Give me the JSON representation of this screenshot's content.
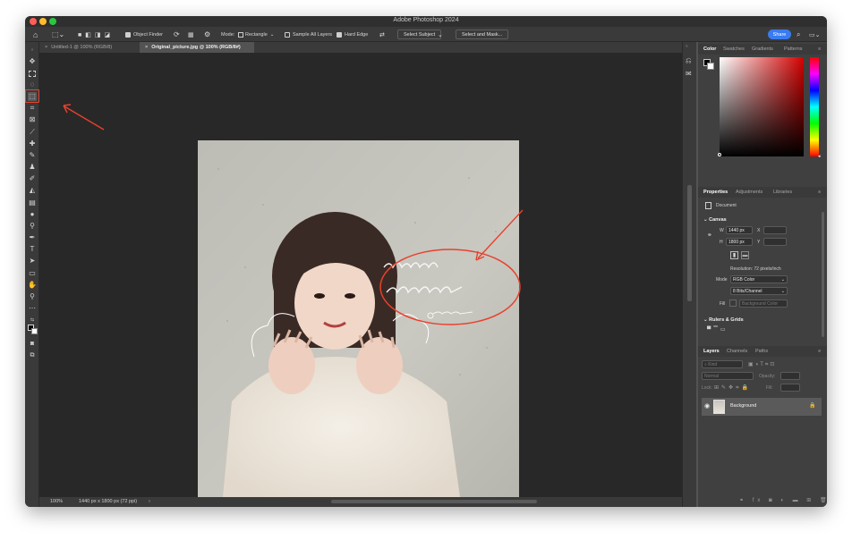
{
  "window": {
    "title": "Adobe Photoshop 2024"
  },
  "options_bar": {
    "object_finder": "Object Finder",
    "mode_label": "Mode:",
    "mode_value": "Rectangle",
    "sample_all_layers": "Sample All Layers",
    "hard_edge": "Hard Edge",
    "select_subject": "Select Subject",
    "select_and_mask": "Select and Mask...",
    "share": "Share"
  },
  "document_tabs": [
    {
      "label": "Untitled-1 @ 100% (RGB/8)",
      "active": false
    },
    {
      "label": "Original_picture.jpg @ 100% (RGB/8#)",
      "active": true
    }
  ],
  "status_bar": {
    "zoom": "100%",
    "doc_info": "1440 px x 1800 px (72 ppi)"
  },
  "color_panel": {
    "tabs": [
      "Color",
      "Swatches",
      "Gradients",
      "Patterns"
    ],
    "active": "Color"
  },
  "properties_panel": {
    "tabs": [
      "Properties",
      "Adjustments",
      "Libraries"
    ],
    "active": "Properties",
    "document_label": "Document",
    "canvas_section": "Canvas",
    "w_label": "W",
    "width": "1440 px",
    "x_label": "X",
    "h_label": "H",
    "height": "1800 px",
    "y_label": "Y",
    "resolution": "Resolution: 72 pixels/inch",
    "mode_label": "Mode",
    "mode_value": "RGB Color",
    "bit_depth": "8 Bits/Channel",
    "fill_label": "Fill",
    "fill_value": "Background Color",
    "rulers_section": "Rulers & Grids"
  },
  "layers_panel": {
    "tabs": [
      "Layers",
      "Channels",
      "Paths"
    ],
    "active": "Layers",
    "search_placeholder": "Kind",
    "blend_mode": "Normal",
    "opacity_label": "Opacity:",
    "lock_label": "Lock:",
    "fill_label": "Fill:",
    "layers": [
      {
        "name": "Background",
        "locked": true,
        "visible": true
      }
    ]
  },
  "annotations": {
    "highlight_color": "#e8412c"
  }
}
